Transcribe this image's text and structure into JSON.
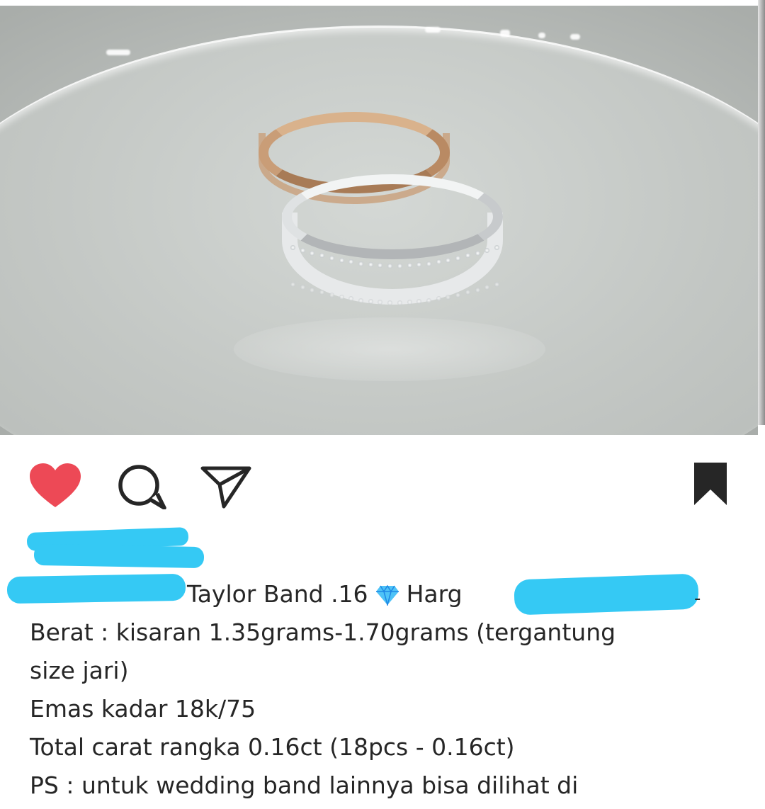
{
  "post": {
    "image_alt": "two wedding rings",
    "actions": {
      "like_icon": "heart-filled-icon",
      "comment_icon": "comment-bubble-icon",
      "share_icon": "paper-plane-icon",
      "save_icon": "bookmark-filled-icon"
    },
    "liked_color": "#ed4956",
    "caption": {
      "line1_text": "Taylor Band .16",
      "line1_after_gem": "Harg",
      "line1_trailing": "-",
      "line2": "Berat : kisaran 1.35grams-1.70grams (tergantung",
      "line3": "size jari)",
      "line4": "Emas  kadar 18k/75",
      "line5": "Total carat rangka 0.16ct (18pcs - 0.16ct)",
      "line6": "PS : untuk wedding band lainnya bisa dilihat di"
    },
    "gem_icon": "diamond-icon"
  }
}
